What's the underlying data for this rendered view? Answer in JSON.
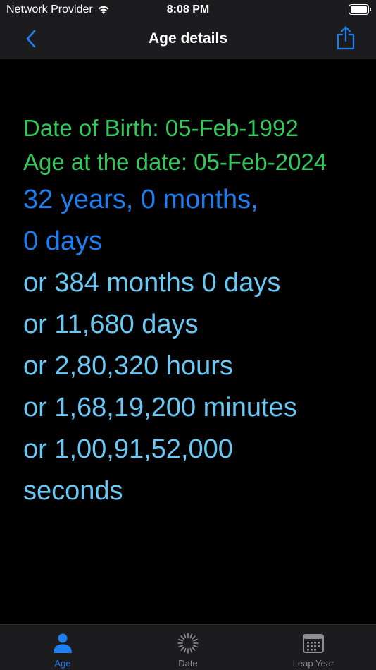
{
  "status_bar": {
    "carrier": "Network Provider",
    "time": "8:08 PM"
  },
  "nav": {
    "title": "Age details",
    "back_icon": "chevron-left-icon",
    "share_icon": "share-icon"
  },
  "details": {
    "dob": "Date of Birth: 05-Feb-1992",
    "age_at": "Age at the date: 05-Feb-2024",
    "ymd_line1": "32 years, 0 months,",
    "ymd_line2": "0 days",
    "months": "or 384 months 0 days",
    "days": "or 11,680 days",
    "hours": "or 2,80,320 hours",
    "minutes": "or 1,68,19,200 minutes",
    "seconds_line1": "or 1,00,91,52,000",
    "seconds_line2": "seconds"
  },
  "tabs": [
    {
      "label": "Age",
      "icon": "person-icon",
      "active": true
    },
    {
      "label": "Date",
      "icon": "sunburst-icon",
      "active": false
    },
    {
      "label": "Leap Year",
      "icon": "calendar-icon",
      "active": false
    }
  ],
  "colors": {
    "accent": "#1e7ff2",
    "green": "#34c759",
    "light_blue": "#6ac8f5",
    "bar_bg": "#1c1c1e"
  }
}
